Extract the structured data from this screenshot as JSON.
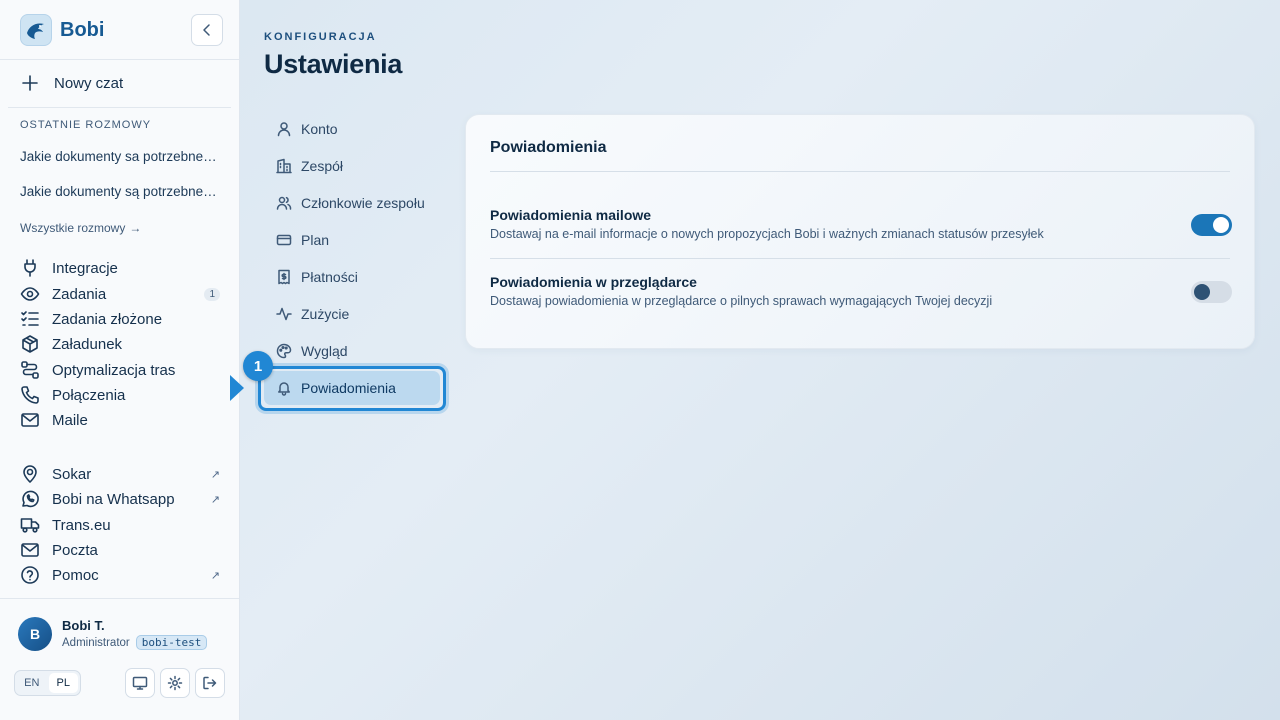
{
  "brand": {
    "name": "Bobi"
  },
  "sidebar": {
    "new_chat": "Nowy czat",
    "recent_label": "OSTATNIE ROZMOWY",
    "recent": [
      "Jakie dokumenty sa potrzebne do przewozu ładunku",
      "Jakie dokumenty są potrzebne do przewozu ładunku"
    ],
    "all_chats": "Wszystkie rozmowy",
    "nav": [
      {
        "label": "Integracje",
        "icon": "plug-icon"
      },
      {
        "label": "Zadania",
        "icon": "eye-icon",
        "badge": "1"
      },
      {
        "label": "Zadania złożone",
        "icon": "checklist-icon"
      },
      {
        "label": "Załadunek",
        "icon": "package-icon"
      },
      {
        "label": "Optymalizacja tras",
        "icon": "route-icon"
      },
      {
        "label": "Połączenia",
        "icon": "phone-icon"
      },
      {
        "label": "Maile",
        "icon": "mail-icon"
      }
    ],
    "links": [
      {
        "label": "Sokar",
        "icon": "map-pin-icon",
        "external": "↗"
      },
      {
        "label": "Bobi na Whatsapp",
        "icon": "whatsapp-icon",
        "external": "↗"
      },
      {
        "label": "Trans.eu",
        "icon": "truck-icon"
      },
      {
        "label": "Poczta",
        "icon": "mail-icon"
      },
      {
        "label": "Pomoc",
        "icon": "help-icon",
        "external": "↗"
      }
    ],
    "user": {
      "initial": "B",
      "name": "Bobi T.",
      "role": "Administrator",
      "tag": "bobi-test"
    },
    "languages": [
      "EN",
      "PL"
    ],
    "active_language": "PL"
  },
  "page": {
    "eyebrow": "KONFIGURACJA",
    "title": "Ustawienia"
  },
  "settings_nav": [
    {
      "label": "Konto",
      "icon": "user-icon"
    },
    {
      "label": "Zespół",
      "icon": "building-icon"
    },
    {
      "label": "Członkowie zespołu",
      "icon": "users-icon"
    },
    {
      "label": "Plan",
      "icon": "credit-card-icon"
    },
    {
      "label": "Płatności",
      "icon": "receipt-icon"
    },
    {
      "label": "Zużycie",
      "icon": "activity-icon"
    },
    {
      "label": "Wygląd",
      "icon": "palette-icon"
    },
    {
      "label": "Powiadomienia",
      "icon": "bell-icon",
      "active": true
    }
  ],
  "marker": {
    "number": "1",
    "color": "#2187d4"
  },
  "notifications": {
    "title": "Powiadomienia",
    "items": [
      {
        "title": "Powiadomienia mailowe",
        "desc": "Dostawaj na e-mail informacje o nowych propozycjach Bobi i ważnych zmianach statusów przesyłek",
        "enabled": true
      },
      {
        "title": "Powiadomienia w przeglądarce",
        "desc": "Dostawaj powiadomienia w przeglądarce o pilnych sprawach wymagających Twojej decyzji",
        "enabled": false
      }
    ]
  },
  "colors": {
    "accent": "#1b76b8",
    "brand": "#175a93",
    "marker": "#2187d4"
  }
}
